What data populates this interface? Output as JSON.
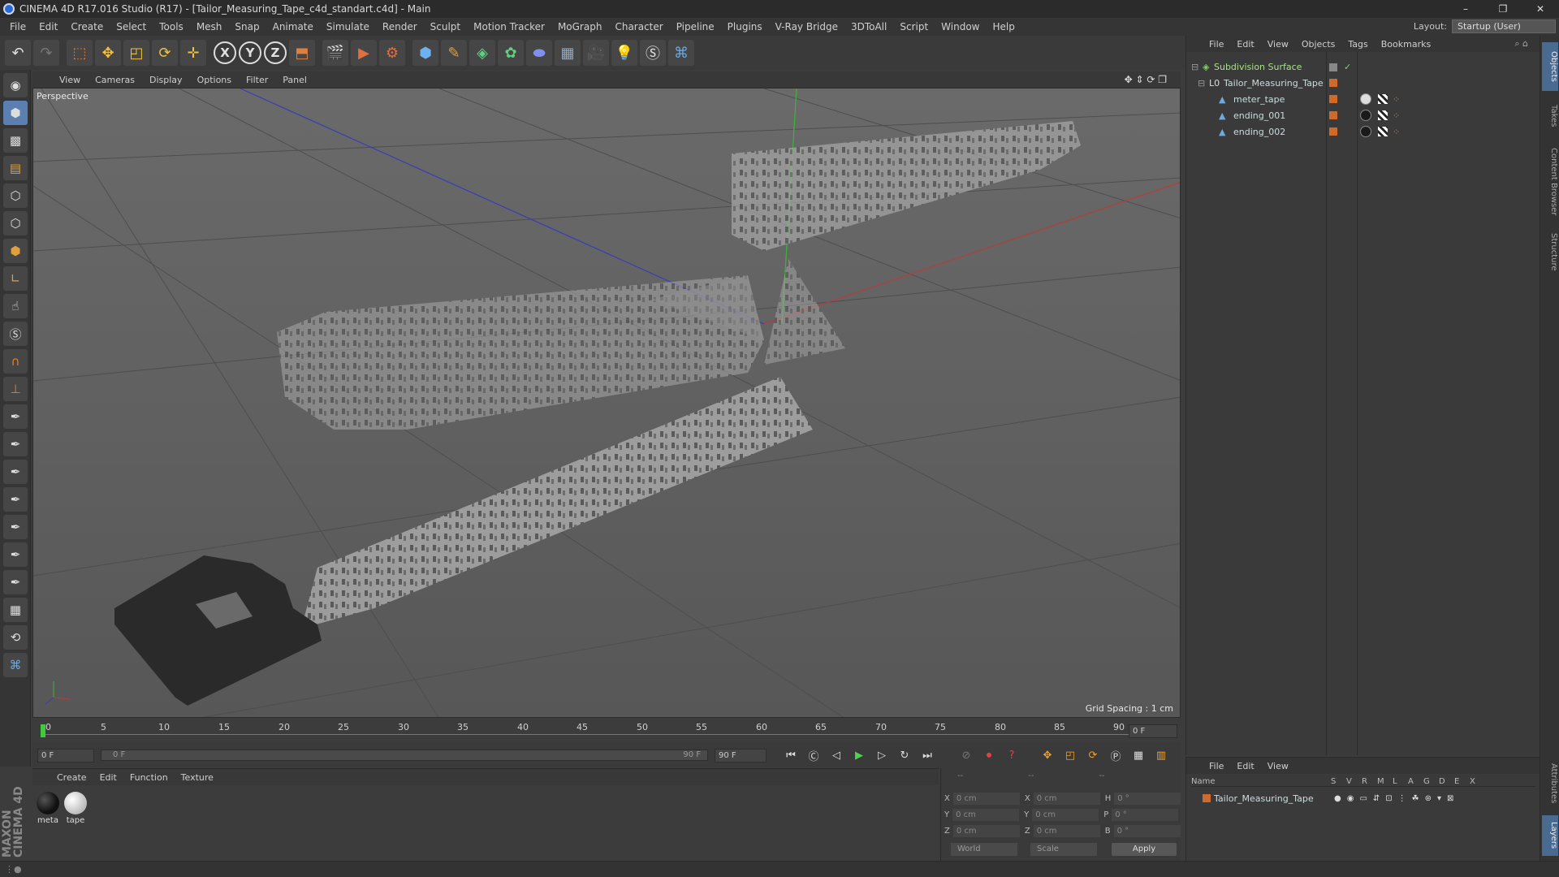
{
  "window": {
    "title": "CINEMA 4D R17.016 Studio (R17) - [Tailor_Measuring_Tape_c4d_standart.c4d] - Main",
    "minimize": "–",
    "restore": "❐",
    "close": "✕"
  },
  "menubar": {
    "items": [
      "File",
      "Edit",
      "Create",
      "Select",
      "Tools",
      "Mesh",
      "Snap",
      "Animate",
      "Simulate",
      "Render",
      "Sculpt",
      "Motion Tracker",
      "MoGraph",
      "Character",
      "Pipeline",
      "Plugins",
      "V-Ray Bridge",
      "3DToAll",
      "Script",
      "Window",
      "Help"
    ],
    "layout_label": "Layout:",
    "layout_value": "Startup (User)"
  },
  "toolbar": {
    "icons": [
      "undo-icon",
      "redo-icon",
      "live-selection-icon",
      "move-icon",
      "scale-icon",
      "rotate-icon",
      "transform-icon",
      "x-axis-icon",
      "y-axis-icon",
      "z-axis-icon",
      "coordinate-system-icon",
      "render-view-icon",
      "render-picture-viewer-icon",
      "edit-render-settings-icon",
      "cube-icon",
      "pen-spline-icon",
      "subdivision-icon",
      "mograph-cloner-icon",
      "deformer-icon",
      "floor-icon",
      "camera-icon",
      "light-icon",
      "vray-icon",
      "python-icon"
    ],
    "axis_x": "X",
    "axis_y": "Y",
    "axis_z": "Z"
  },
  "viewport": {
    "menu": [
      "View",
      "Cameras",
      "Display",
      "Options",
      "Filter",
      "Panel"
    ],
    "label": "Perspective",
    "grid_spacing": "Grid Spacing : 1 cm"
  },
  "timeline": {
    "ticks": [
      "0",
      "5",
      "10",
      "15",
      "20",
      "25",
      "30",
      "35",
      "40",
      "45",
      "50",
      "55",
      "60",
      "65",
      "70",
      "75",
      "80",
      "85",
      "90"
    ],
    "current_frame": "0 F"
  },
  "transport": {
    "start_field": "0 F",
    "range_start": "0 F",
    "range_end": "90 F",
    "end_field": "90 F"
  },
  "materials": {
    "menu": [
      "Create",
      "Edit",
      "Function",
      "Texture"
    ],
    "items": [
      {
        "name": "meta",
        "color": "#111111"
      },
      {
        "name": "tape",
        "color": "#e8e8e8"
      }
    ]
  },
  "coordinates": {
    "header": [
      "--",
      "--",
      "--"
    ],
    "rows": [
      {
        "a": "X",
        "av": "0 cm",
        "b": "X",
        "bv": "0 cm",
        "c": "H",
        "cv": "0 °"
      },
      {
        "a": "Y",
        "av": "0 cm",
        "b": "Y",
        "bv": "0 cm",
        "c": "P",
        "cv": "0 °"
      },
      {
        "a": "Z",
        "av": "0 cm",
        "b": "Z",
        "bv": "0 cm",
        "c": "B",
        "cv": "0 °"
      }
    ],
    "mode": "World",
    "scale": "Scale",
    "apply": "Apply"
  },
  "objects": {
    "menu": [
      "File",
      "Edit",
      "View",
      "Objects",
      "Tags",
      "Bookmarks"
    ],
    "tree": [
      {
        "name": "Subdivision Surface",
        "level": 0,
        "color": "#7fd36a"
      },
      {
        "name": "Tailor_Measuring_Tape",
        "level": 1,
        "color": "#cdd"
      },
      {
        "name": "meter_tape",
        "level": 2,
        "color": "#cdd"
      },
      {
        "name": "ending_001",
        "level": 2,
        "color": "#cdd"
      },
      {
        "name": "ending_002",
        "level": 2,
        "color": "#cdd"
      }
    ]
  },
  "layers": {
    "menu": [
      "File",
      "Edit",
      "View"
    ],
    "headers": [
      "Name",
      "S",
      "V",
      "R",
      "M",
      "L",
      "A",
      "G",
      "D",
      "E",
      "X"
    ],
    "row_name": "Tailor_Measuring_Tape"
  },
  "right_tabs": [
    "Objects",
    "Takes",
    "Content Browser",
    "Structure",
    "Attributes",
    "Layers"
  ],
  "brand": "MAXON CINEMA 4D",
  "colors": {
    "accent": "#5a7fb0",
    "orange": "#d06a2a",
    "viewport_bg": "#585858"
  }
}
